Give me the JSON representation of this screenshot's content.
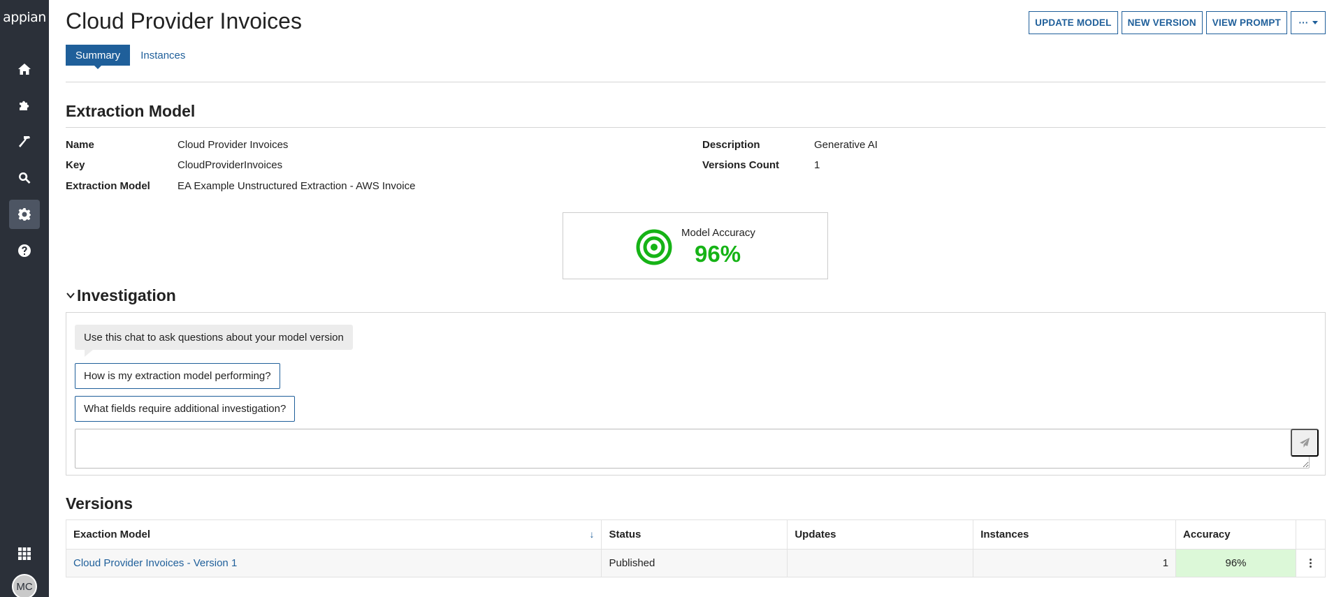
{
  "sidebar": {
    "logo": "appian",
    "avatar_initials": "MC",
    "items": [
      {
        "icon": "home-icon"
      },
      {
        "icon": "puzzle-icon"
      },
      {
        "icon": "hammer-icon"
      },
      {
        "icon": "search-icon"
      },
      {
        "icon": "gear-icon",
        "active": true
      },
      {
        "icon": "help-icon"
      }
    ],
    "apps_icon": "grid-icon"
  },
  "header": {
    "title": "Cloud Provider Invoices",
    "actions": {
      "update_model": "UPDATE MODEL",
      "new_version": "NEW VERSION",
      "view_prompt": "VIEW PROMPT",
      "more": "···"
    }
  },
  "tabs": {
    "summary": "Summary",
    "instances": "Instances"
  },
  "extraction_model": {
    "heading": "Extraction Model",
    "name_label": "Name",
    "name_value": "Cloud Provider Invoices",
    "key_label": "Key",
    "key_value": "CloudProviderInvoices",
    "model_label": "Extraction Model",
    "model_value": "EA Example Unstructured Extraction - AWS Invoice",
    "description_label": "Description",
    "description_value": "Generative AI",
    "versions_count_label": "Versions Count",
    "versions_count_value": "1",
    "accuracy_label": "Model Accuracy",
    "accuracy_value": "96%"
  },
  "investigation": {
    "heading": "Investigation",
    "bubble": "Use this chat to ask questions about your model version",
    "suggestion_1": "How is my extraction model performing?",
    "suggestion_2": "What fields require additional investigation?",
    "input_value": ""
  },
  "versions": {
    "heading": "Versions",
    "columns": {
      "model": "Exaction Model",
      "status": "Status",
      "updates": "Updates",
      "instances": "Instances",
      "accuracy": "Accuracy"
    },
    "rows": [
      {
        "model": "Cloud Provider Invoices - Version 1",
        "status": "Published",
        "updates": "",
        "instances": "1",
        "accuracy": "96%"
      }
    ]
  },
  "colors": {
    "sidebar_bg": "#2b3039",
    "accent_blue": "#1f5f9a",
    "accuracy_green": "#16b316",
    "accuracy_cell_bg": "#dcf8d8"
  }
}
